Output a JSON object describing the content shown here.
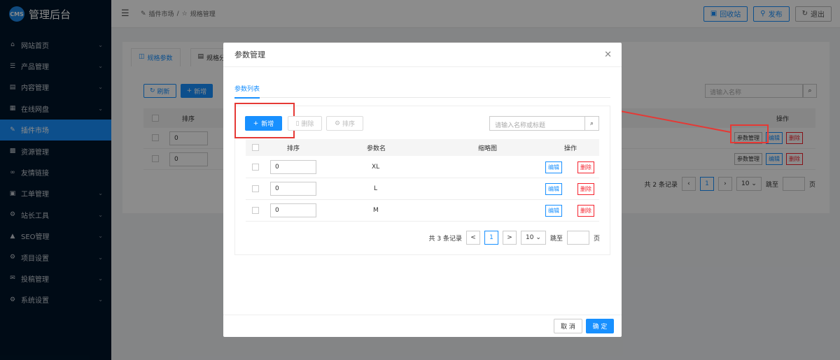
{
  "app": {
    "logo_badge": "CMS",
    "title": "管理后台"
  },
  "sidebar": {
    "items": [
      {
        "label": "网站首页",
        "icon": "home-icon",
        "glyph": "⌂",
        "caret": true
      },
      {
        "label": "产品管理",
        "icon": "list-icon",
        "glyph": "☰",
        "caret": true
      },
      {
        "label": "内容管理",
        "icon": "document-icon",
        "glyph": "▤",
        "caret": true
      },
      {
        "label": "在线网盘",
        "icon": "grid-icon",
        "glyph": "▦",
        "caret": true
      },
      {
        "label": "插件市场",
        "icon": "pin-icon",
        "glyph": "✎",
        "caret": false,
        "active": true
      },
      {
        "label": "资源管理",
        "icon": "apps-icon",
        "glyph": "▩",
        "caret": false
      },
      {
        "label": "友情链接",
        "icon": "link-icon",
        "glyph": "∞",
        "caret": false
      },
      {
        "label": "工单管理",
        "icon": "ticket-icon",
        "glyph": "▣",
        "caret": true
      },
      {
        "label": "站长工具",
        "icon": "tools-icon",
        "glyph": "⚙",
        "caret": true
      },
      {
        "label": "SEO管理",
        "icon": "warning-icon",
        "glyph": "▲",
        "caret": true
      },
      {
        "label": "项目设置",
        "icon": "settings-icon",
        "glyph": "⚙",
        "caret": true
      },
      {
        "label": "投稿管理",
        "icon": "mail-icon",
        "glyph": "✉",
        "caret": true
      },
      {
        "label": "系统设置",
        "icon": "gear-icon",
        "glyph": "⚙",
        "caret": true
      }
    ]
  },
  "topbar": {
    "breadcrumb": [
      "插件市场",
      "规格管理"
    ],
    "separator": "/",
    "actions": {
      "recycle": "回收站",
      "publish": "发布",
      "logout": "退出"
    }
  },
  "background": {
    "tabs": [
      "规格参数",
      "规格分"
    ],
    "refresh": "刷新",
    "add": "新增",
    "search_placeholder": "请输入名称",
    "col_sort": "排序",
    "col_ops": "操作",
    "rows": [
      {
        "sort": "0",
        "manage": "参数管理",
        "edit": "编辑",
        "del": "删除"
      },
      {
        "sort": "0",
        "manage": "参数管理",
        "edit": "编辑",
        "del": "删除"
      }
    ],
    "pager": {
      "total": "共 2 条记录",
      "page": "1",
      "size": "10",
      "jump": "跳至",
      "page_unit": "页"
    }
  },
  "modal": {
    "title": "参数管理",
    "tab": "参数列表",
    "toolbar": {
      "add": "新增",
      "delete": "删除",
      "sort": "排序"
    },
    "search_placeholder": "请输入名称或标题",
    "columns": {
      "sort": "排序",
      "name": "参数名",
      "thumb": "缩略图",
      "ops": "操作"
    },
    "rows": [
      {
        "sort": "0",
        "name": "XL",
        "edit": "编辑",
        "del": "删除"
      },
      {
        "sort": "0",
        "name": "L",
        "edit": "编辑",
        "del": "删除"
      },
      {
        "sort": "0",
        "name": "M",
        "edit": "编辑",
        "del": "删除"
      }
    ],
    "pager": {
      "total": "共 3 条记录",
      "prev": "<",
      "page": "1",
      "next": ">",
      "size": "10",
      "jump": "跳至",
      "page_unit": "页"
    },
    "footer": {
      "cancel": "取 消",
      "ok": "确 定"
    }
  },
  "colors": {
    "primary": "#1890ff",
    "sidebar": "#001529",
    "danger": "#f5222d",
    "annotation": "#e53935"
  }
}
